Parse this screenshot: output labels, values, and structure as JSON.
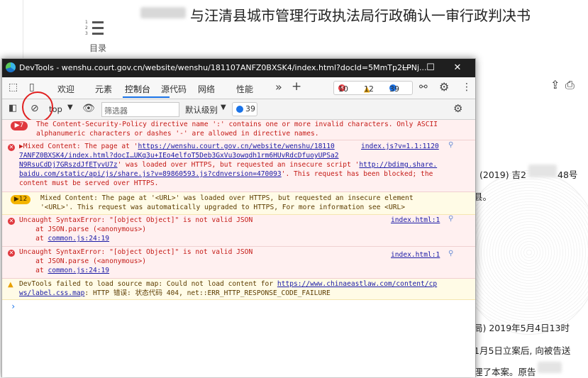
{
  "page": {
    "title": "与汪清县城市管理行政执法局行政确认一审行政判决书",
    "toc_label": "目录",
    "toc_numbers": [
      "1",
      "2",
      "3"
    ],
    "case_no_prefix": "(2019) 吉2",
    "case_no_suffix": "48号",
    "text_frag_1": "县。",
    "text_frag_2": "局) 2019年5月4日13时",
    "text_frag_3": "1月5日立案后, 向被告送",
    "text_frag_4": "理了本案。原告",
    "icons": [
      "download-icon",
      "print-icon"
    ]
  },
  "devtools": {
    "window_title": "DevTools - wenshu.court.gov.cn/website/wenshu/181107ANFZ0BXSK4/index.html?docId=5MmTp2LPNj...",
    "window_buttons": [
      "minimize",
      "maximize",
      "close"
    ],
    "tabs": [
      {
        "label": "欢迎"
      },
      {
        "label": "元素"
      },
      {
        "label": "控制台",
        "active": true
      },
      {
        "label": "源代码"
      },
      {
        "label": "网络"
      },
      {
        "label": "性能"
      }
    ],
    "counts": {
      "errors": "10",
      "warnings": "12",
      "info": "39"
    },
    "toolbar": {
      "context": "top",
      "filter_placeholder": "筛选器",
      "level": "默认级别",
      "issues": "39"
    },
    "messages": {
      "m1": {
        "count": "7",
        "l1": "The Content-Security-Policy directive name ':' contains one or more invalid characters. Only ASCII",
        "l2": "alphanumeric characters or dashes '-' are allowed in directive names."
      },
      "m2": {
        "prefix": "Mixed Content: The page at '",
        "url1a": "https://wenshu.court.gov.cn/website/wenshu/18110",
        "url1b": "7ANFZ0BXSK4/index.html?docI…UKq3u+IEo4elfoT5Deb3GxVu3owqdh1rm6HUvRdcDfuoyUPSa2",
        "url1c": "N9RsuCdDj7GRszdJfETyvU7z",
        "mid1": "' was loaded over HTTPS, but requested an insecure script '",
        "url2a": "http://bdimg.share.",
        "url2b": "baidu.com/static/api/js/share.js?v=89860593.js?cdnversion=470093",
        "tail1": "'. This request has been blocked; the",
        "l5": "content must be served over HTTPS.",
        "source": "index.js?v=1.1:1120"
      },
      "m3": {
        "count": "12",
        "l1": "Mixed Content: The page at '<URL>' was loaded over HTTPS, but requested an insecure element",
        "l2": "'<URL>'. This request was automatically upgraded to HTTPS, For more information see <URL>"
      },
      "m4": {
        "l1": "Uncaught SyntaxError: \"[object Object]\" is not valid JSON",
        "l2": "    at JSON.parse (<anonymous>)",
        "l3_pre": "    at ",
        "l3_link": "common.js:24:19",
        "source": "index.html:1"
      },
      "m5": {
        "l1": "Uncaught SyntaxError: \"[object Object]\" is not valid JSON",
        "l2": "    at JSON.parse (<anonymous>)",
        "l3_pre": "    at ",
        "l3_link": "common.js:24:19",
        "source": "index.html:1"
      },
      "m6": {
        "l1_pre": "DevTools failed to load source map: Could not load content for ",
        "l1_link": "https://www.chinaeastlaw.com/content/cp",
        "l2_link": "ws/label.css.map",
        "l2_rest": ": HTTP 错误: 状态代码 404, net::ERR_HTTP_RESPONSE_CODE_FAILURE"
      }
    },
    "prompt": "›"
  }
}
